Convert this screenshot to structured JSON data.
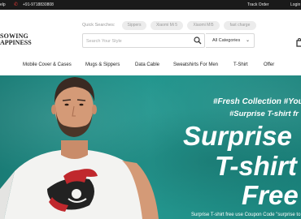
{
  "topbar": {
    "help": "elp",
    "phone": "+91-9718830808",
    "track_order": "Track Order",
    "login": "Login"
  },
  "logo": {
    "line1": "SOWING",
    "line2": "APPINESS"
  },
  "quick_searches": {
    "label": "Quick Searches:",
    "chips": [
      "Sippers",
      "Xiaomi Mi 5",
      "Xiaomi MI5",
      "fast charge"
    ]
  },
  "search": {
    "placeholder": "Search Your Style",
    "category": "All Categories"
  },
  "nav": {
    "items": [
      "Mobile Cover & Cases",
      "Mugs & Sippers",
      "Data Cable",
      "Sweatshirts For Men",
      "T-Shirt",
      "Offer"
    ]
  },
  "hero": {
    "collection": "#Fresh Collection #You",
    "subtag": "#Surprise T-shirt fr",
    "big_line1": "Surprise",
    "big_line2": "T-shirt",
    "big_line3": "Free",
    "footer": "Surprise T-shirt free use Coupon Code \"surprise to"
  },
  "colors": {
    "topbar_bg": "#1a1a1a",
    "hero_bg": "#1f8a83",
    "phone_icon": "#e53935"
  }
}
